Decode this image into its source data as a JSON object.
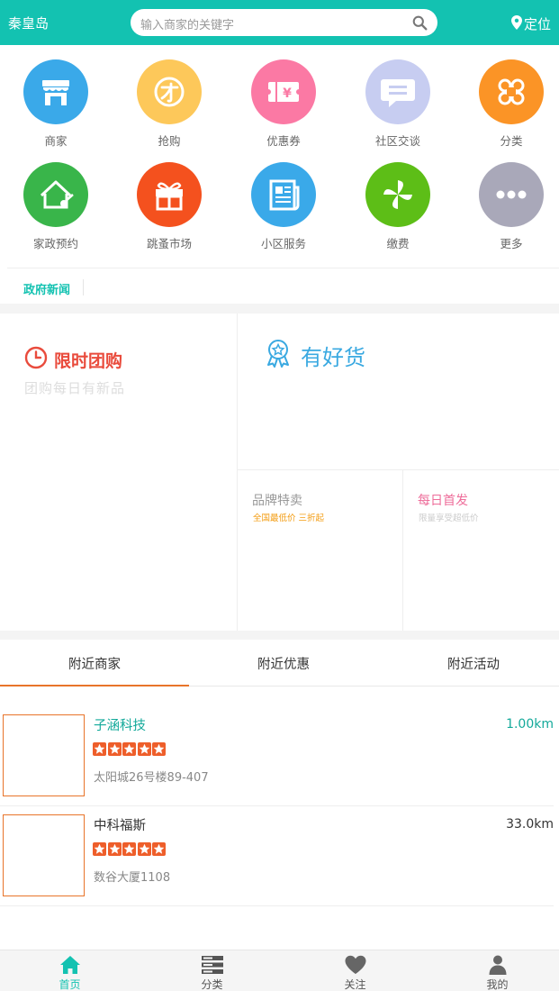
{
  "header": {
    "city": "秦皇岛",
    "search_placeholder": "输入商家的关键字",
    "locate_label": "定位"
  },
  "grid": [
    {
      "label": "商家",
      "icon": "store-icon",
      "color": "#3aa9e9"
    },
    {
      "label": "抢购",
      "icon": "rush-buy-icon",
      "color": "#fdc85a"
    },
    {
      "label": "优惠券",
      "icon": "coupon-icon",
      "color": "#fb79a4"
    },
    {
      "label": "社区交谈",
      "icon": "chat-icon",
      "color": "#c7cdf1"
    },
    {
      "label": "分类",
      "icon": "category-icon",
      "color": "#fb9426"
    },
    {
      "label": "家政预约",
      "icon": "housekeeping-icon",
      "color": "#39b54a"
    },
    {
      "label": "跳蚤市场",
      "icon": "gift-icon",
      "color": "#f4511e"
    },
    {
      "label": "小区服务",
      "icon": "newspaper-icon",
      "color": "#3aa9e9"
    },
    {
      "label": "缴费",
      "icon": "pinwheel-icon",
      "color": "#5dbe17"
    },
    {
      "label": "更多",
      "icon": "more-icon",
      "color": "#a9a8b9"
    }
  ],
  "news": {
    "label": "政府新闻"
  },
  "promo": {
    "flash_title": "限时团购",
    "flash_sub": "团购每日有新品",
    "goods_title": "有好货",
    "brand_title": "品牌特卖",
    "brand_sub": "全国最低价 三折起",
    "daily_title": "每日首发",
    "daily_sub": "限量享受超低价"
  },
  "tabs": [
    {
      "label": "附近商家",
      "active": true
    },
    {
      "label": "附近优惠",
      "active": false
    },
    {
      "label": "附近活动",
      "active": false
    }
  ],
  "merchants": [
    {
      "name": "子涵科技",
      "distance": "1.00km",
      "rating": 5,
      "address": "太阳城26号楼89-407",
      "name_color": "#13a99a",
      "distance_color": "#13a99a"
    },
    {
      "name": "中科福斯",
      "distance": "33.0km",
      "rating": 5,
      "address": "数谷大厦1108",
      "name_color": "#333333",
      "distance_color": "#333333"
    }
  ],
  "bottom_nav": [
    {
      "label": "首页",
      "icon": "home-icon",
      "active": true
    },
    {
      "label": "分类",
      "icon": "list-icon",
      "active": false
    },
    {
      "label": "关注",
      "icon": "heart-icon",
      "active": false
    },
    {
      "label": "我的",
      "icon": "user-icon",
      "active": false
    }
  ],
  "colors": {
    "brand": "#13c2b1",
    "accent": "#e8742a"
  }
}
